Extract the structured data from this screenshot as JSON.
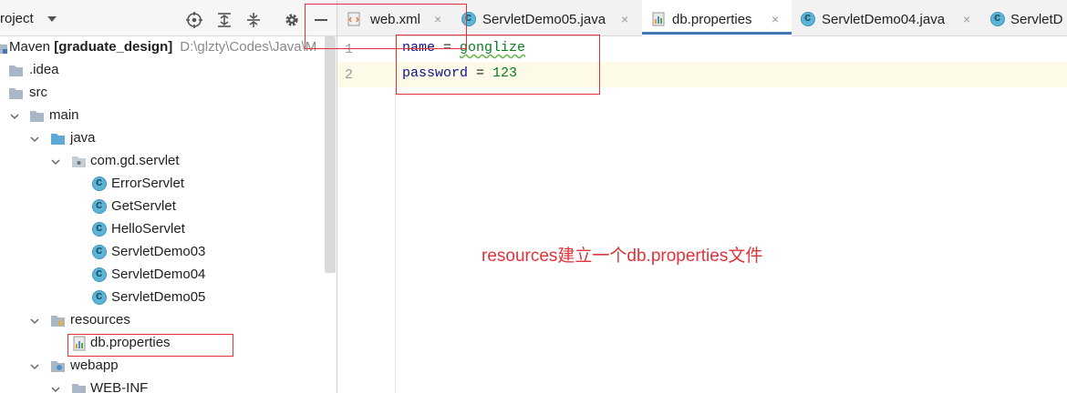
{
  "project": {
    "title": "roject"
  },
  "tree": {
    "root": {
      "name": "Maven ",
      "module": "[graduate_design]",
      "path": "D:\\glzty\\Codes\\Java\\M"
    },
    "idea": ".idea",
    "src": "src",
    "main": "main",
    "java": "java",
    "package": "com.gd.servlet",
    "classes": [
      "ErrorServlet",
      "GetServlet",
      "HelloServlet",
      "ServletDemo03",
      "ServletDemo04",
      "ServletDemo05"
    ],
    "resources": "resources",
    "dbprops": "db.properties",
    "webapp": "webapp",
    "webinf": "WEB-INF"
  },
  "tabs": [
    {
      "label": "web.xml",
      "icon": "xml-file-icon"
    },
    {
      "label": "ServletDemo05.java",
      "icon": "class-icon"
    },
    {
      "label": "db.properties",
      "icon": "properties-file-icon",
      "active": true
    },
    {
      "label": "ServletDemo04.java",
      "icon": "class-icon"
    },
    {
      "label": "ServletD",
      "icon": "class-icon"
    }
  ],
  "close_glyph": "×",
  "editor": {
    "line_numbers": [
      "1",
      "2"
    ],
    "lines": [
      {
        "key": "name",
        "eq": " = ",
        "value": "gonglize"
      },
      {
        "key": "password",
        "eq": " = ",
        "value": "123"
      }
    ]
  },
  "annotation": "resources建立一个db.properties文件",
  "colors": {
    "highlight": "#e0333a",
    "accent": "#3f79b6",
    "class_icon": "#5cb4d6",
    "folder": "#a9b7c6"
  }
}
